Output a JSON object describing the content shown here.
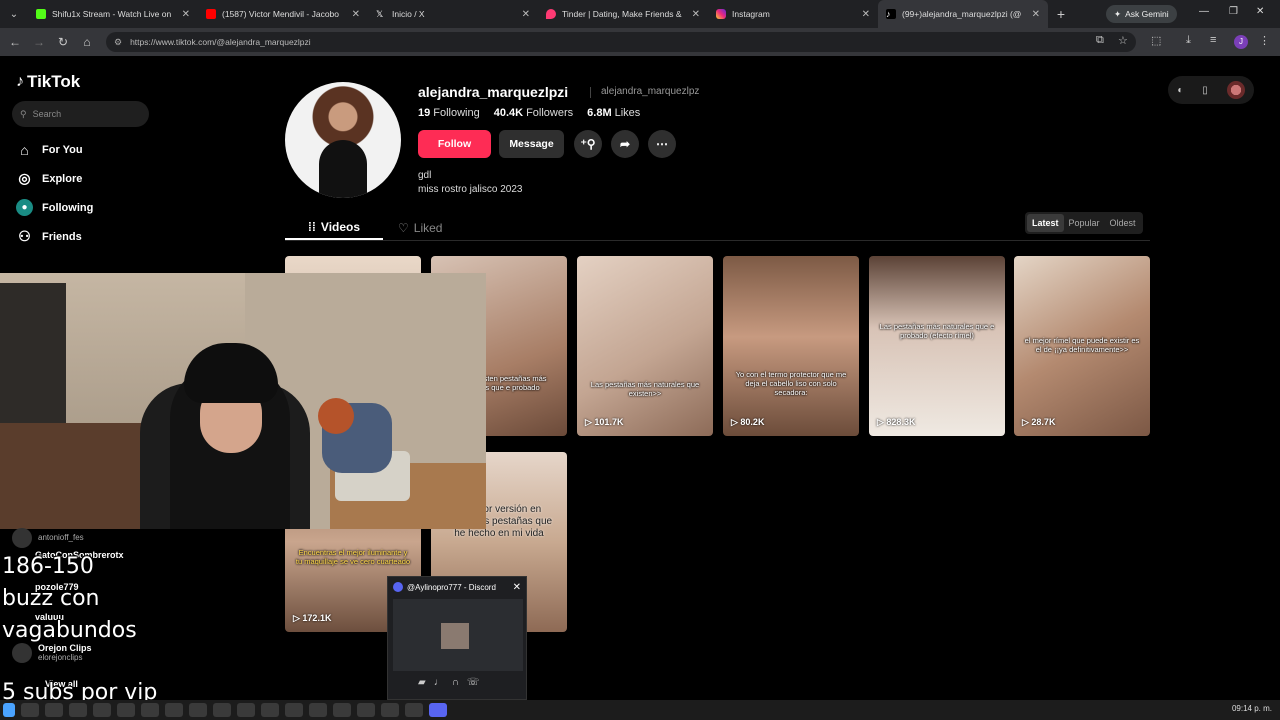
{
  "browser": {
    "tabs": [
      {
        "label": "Shifu1x Stream - Watch Live on",
        "color": "#53fc18",
        "active": false
      },
      {
        "label": "(1587) Victor Mendivil - Jacobo",
        "color": "#ff0000",
        "active": false
      },
      {
        "label": "Inicio / X",
        "color": "#ffffff",
        "active": false
      },
      {
        "label": "Tinder | Dating, Make Friends &",
        "color": "#fd3a73",
        "active": false
      },
      {
        "label": "Instagram",
        "color": "#e1306c",
        "active": false
      },
      {
        "label": "(99+)alejandra_marquezlpzi (@",
        "color": "#ffffff",
        "active": true
      }
    ],
    "ask_gemini": "Ask Gemini",
    "url": "https://www.tiktok.com/@alejandra_marquezlpzi",
    "profile_initial": "J"
  },
  "tiktok": {
    "logo": "TikTok",
    "search_placeholder": "Search",
    "nav": [
      {
        "label": "For You",
        "icon": "home-icon"
      },
      {
        "label": "Explore",
        "icon": "compass-icon"
      },
      {
        "label": "Following",
        "icon": "following-icon"
      },
      {
        "label": "Friends",
        "icon": "friends-icon"
      }
    ],
    "profile": {
      "username": "alejandra_marquezlpzi",
      "handle": "alejandra_marquezlpz",
      "following_count": "19",
      "following_label": "Following",
      "followers_count": "40.4K",
      "followers_label": "Followers",
      "likes_count": "6.8M",
      "likes_label": "Likes",
      "follow_label": "Follow",
      "message_label": "Message",
      "bio_line1": "gdl",
      "bio_line2": "miss rostro jalisco 2023"
    },
    "tabs": {
      "videos": "Videos",
      "liked": "Liked"
    },
    "sort": [
      "Latest",
      "Popular",
      "Oldest"
    ],
    "videos_row1": [
      {
        "caption": "",
        "views": ""
      },
      {
        "caption": "lo que existen pestañas más naturales que e probado",
        "views": ""
      },
      {
        "caption": "Las pestañas más naturales que existen>>",
        "views": "101.7K"
      },
      {
        "caption": "Yo con el termo protector que me deja el cabello liso con solo secadora:",
        "views": "80.2K"
      },
      {
        "caption": "Las pestañas más naturales que e probado (efecto rímel)",
        "views": "828.3K"
      },
      {
        "caption": "el mejor rímel que puede existir es el de ¡¡ya definitivamente>>",
        "views": "28.7K"
      }
    ],
    "videos_row2": [
      {
        "caption": "Encuentras el mejor iluminante y tu maquillaje se ve cero cuarteado",
        "views": "172.1K"
      },
      {
        "caption": "la mejor versión en máscaras pestañas que he hecho en mi vida",
        "views": ""
      }
    ]
  },
  "stream_overlay": {
    "chat_users": [
      {
        "name": "",
        "sub": "antonioff_fes"
      },
      {
        "name": "GatoConSombrerotx",
        "sub": ""
      },
      {
        "name": "pozole779",
        "sub": ""
      },
      {
        "name": "valuuu",
        "sub": ""
      },
      {
        "name": "Orejon Clips",
        "sub": "elorejonclips"
      },
      {
        "name": "View all",
        "sub": ""
      }
    ],
    "text_lines": [
      "186-150",
      "buzz con",
      "vagabundos",
      "5 subs por vip"
    ],
    "discord_title": "@Aylinopro777 - Discord"
  },
  "taskbar": {
    "clock": "09:14 p. m."
  }
}
